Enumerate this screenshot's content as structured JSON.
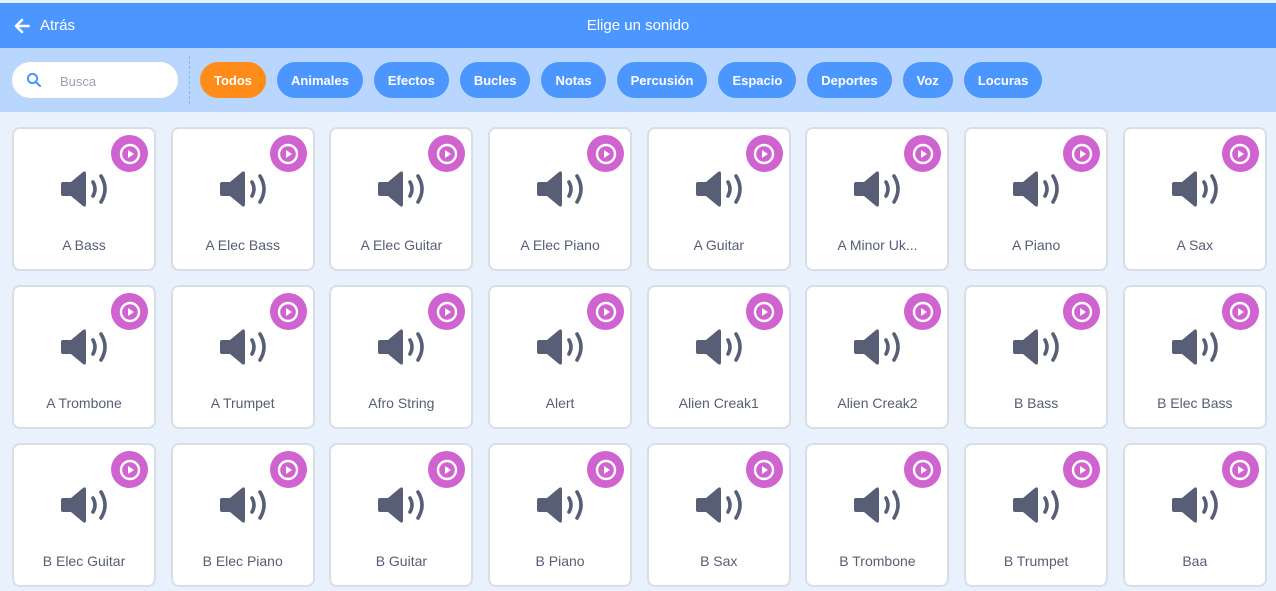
{
  "header": {
    "back_label": "Atrás",
    "title": "Elige un sonido"
  },
  "search": {
    "placeholder": "Busca",
    "value": ""
  },
  "tags": [
    {
      "label": "Todos",
      "active": true
    },
    {
      "label": "Animales",
      "active": false
    },
    {
      "label": "Efectos",
      "active": false
    },
    {
      "label": "Bucles",
      "active": false
    },
    {
      "label": "Notas",
      "active": false
    },
    {
      "label": "Percusión",
      "active": false
    },
    {
      "label": "Espacio",
      "active": false
    },
    {
      "label": "Deportes",
      "active": false
    },
    {
      "label": "Voz",
      "active": false
    },
    {
      "label": "Locuras",
      "active": false
    }
  ],
  "colors": {
    "header": "#4c97ff",
    "filter_bar": "#b9d6ff",
    "active_tag": "#ff8c1a",
    "tag": "#4c97ff",
    "play_button": "#cf63cf",
    "speaker_icon": "#575e75"
  },
  "icons": {
    "back": "arrow-left-icon",
    "search": "magnifier-icon",
    "play": "play-icon",
    "sound": "speaker-icon"
  },
  "sounds": [
    "A Bass",
    "A Elec Bass",
    "A Elec Guitar",
    "A Elec Piano",
    "A Guitar",
    "A Minor Uk...",
    "A Piano",
    "A Sax",
    "A Trombone",
    "A Trumpet",
    "Afro String",
    "Alert",
    "Alien Creak1",
    "Alien Creak2",
    "B Bass",
    "B Elec Bass",
    "B Elec Guitar",
    "B Elec Piano",
    "B Guitar",
    "B Piano",
    "B Sax",
    "B Trombone",
    "B Trumpet",
    "Baa"
  ]
}
